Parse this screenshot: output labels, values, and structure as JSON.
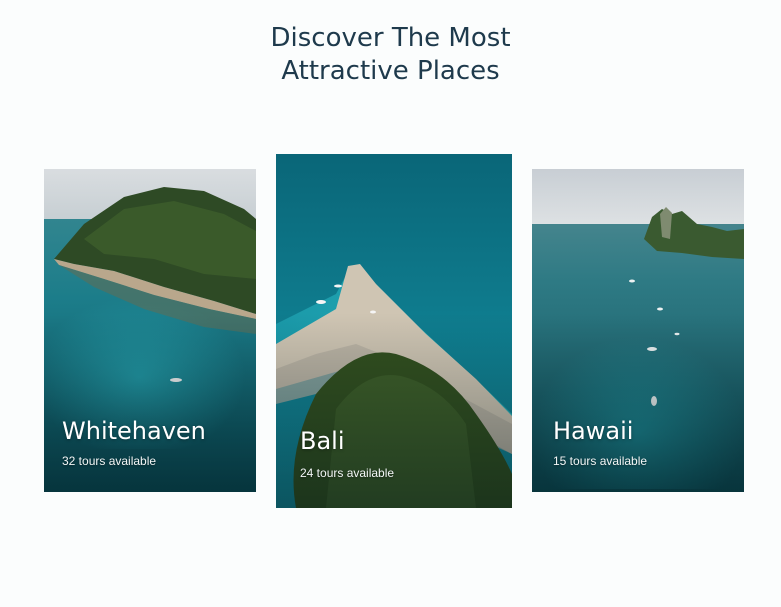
{
  "heading": {
    "line1": "Discover The Most",
    "line2": "Attractive Places"
  },
  "destinations": [
    {
      "name": "Whitehaven",
      "tours": "32 tours available"
    },
    {
      "name": "Bali",
      "tours": "24 tours available"
    },
    {
      "name": "Hawaii",
      "tours": "15 tours available"
    }
  ],
  "colors": {
    "heading_text": "#1e3a4c",
    "background": "#fbfdfd",
    "card_text": "#ffffff"
  }
}
